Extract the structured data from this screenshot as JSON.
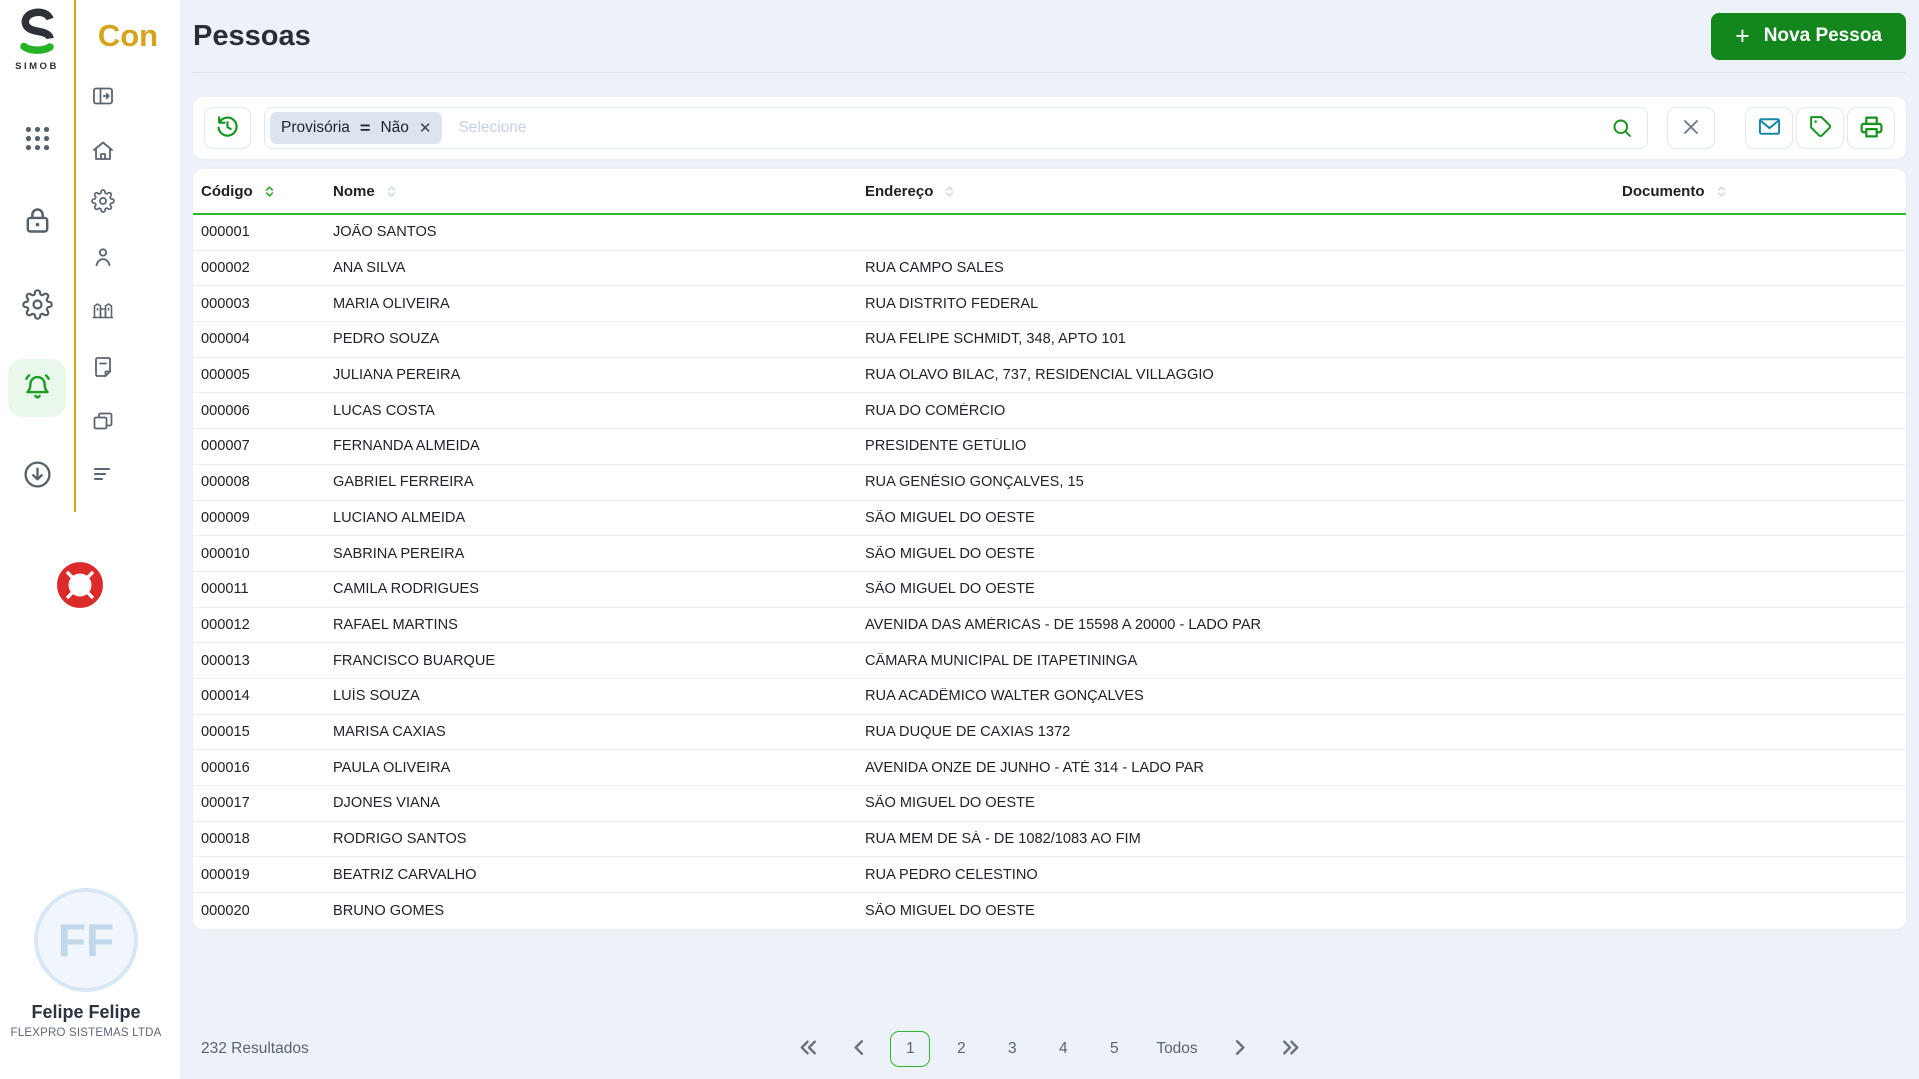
{
  "brand": {
    "logo_letter": "S",
    "logo_caption": "SIMOB",
    "app_name": "Con"
  },
  "sidebar": {
    "outer_items": [
      {
        "name": "apps-grid-icon",
        "active": false
      },
      {
        "name": "lock-icon",
        "active": false
      },
      {
        "name": "gear-icon",
        "active": false
      },
      {
        "name": "bell-icon",
        "active": true
      },
      {
        "name": "download-icon",
        "active": false
      }
    ],
    "inner_items": [
      {
        "name": "panel-expand-icon"
      },
      {
        "name": "home-icon"
      },
      {
        "name": "gear-icon"
      },
      {
        "name": "user-icon"
      },
      {
        "name": "building-icon"
      },
      {
        "name": "note-icon"
      },
      {
        "name": "copy-icon"
      },
      {
        "name": "align-left-icon"
      }
    ],
    "help_icon": "lifebuoy-icon"
  },
  "header": {
    "title": "Pessoas",
    "new_button_plus": "+",
    "new_button_label": "Nova Pessoa"
  },
  "filter": {
    "chip": {
      "field": "Provisória",
      "operator": "=",
      "value": "Não",
      "remove_label": "✕"
    },
    "placeholder": "Selecione"
  },
  "table": {
    "columns": [
      {
        "label": "Código",
        "sort_active": true
      },
      {
        "label": "Nome",
        "sort_active": false
      },
      {
        "label": "Endereço",
        "sort_active": false
      },
      {
        "label": "Documento",
        "sort_active": false
      }
    ],
    "rows": [
      {
        "code": "000001",
        "name": "JOÃO SANTOS",
        "address": "",
        "document": ""
      },
      {
        "code": "000002",
        "name": "ANA SILVA",
        "address": "RUA CAMPO SALES",
        "document": ""
      },
      {
        "code": "000003",
        "name": "MARIA OLIVEIRA",
        "address": "RUA DISTRITO FEDERAL",
        "document": ""
      },
      {
        "code": "000004",
        "name": "PEDRO SOUZA",
        "address": "RUA FELIPE SCHMIDT, 348, APTO 101",
        "document": ""
      },
      {
        "code": "000005",
        "name": "JULIANA PEREIRA",
        "address": "RUA OLAVO BILAC, 737, RESIDENCIAL VILLAGGIO",
        "document": ""
      },
      {
        "code": "000006",
        "name": "LUCAS COSTA",
        "address": "RUA DO COMÉRCIO",
        "document": ""
      },
      {
        "code": "000007",
        "name": "FERNANDA ALMEIDA",
        "address": "PRESIDENTE GETÚLIO",
        "document": ""
      },
      {
        "code": "000008",
        "name": "GABRIEL FERREIRA",
        "address": "RUA GENÉSIO GONÇALVES, 15",
        "document": ""
      },
      {
        "code": "000009",
        "name": "LUCIANO ALMEIDA",
        "address": "SÃO MIGUEL DO OESTE",
        "document": ""
      },
      {
        "code": "000010",
        "name": "SABRINA PEREIRA",
        "address": "SÃO MIGUEL DO OESTE",
        "document": ""
      },
      {
        "code": "000011",
        "name": "CAMILA RODRIGUES",
        "address": "SÃO MIGUEL DO OESTE",
        "document": ""
      },
      {
        "code": "000012",
        "name": "RAFAEL MARTINS",
        "address": "AVENIDA DAS AMÉRICAS - DE 15598 A 20000 - LADO PAR",
        "document": ""
      },
      {
        "code": "000013",
        "name": "FRANCISCO BUARQUE",
        "address": "CÂMARA MUNICIPAL DE ITAPETININGA",
        "document": ""
      },
      {
        "code": "000014",
        "name": "LUÍS SOUZA",
        "address": "RUA ACADÊMICO WALTER GONÇALVES",
        "document": ""
      },
      {
        "code": "000015",
        "name": "MARISA CAXIAS",
        "address": "RUA DUQUE DE CAXIAS 1372",
        "document": ""
      },
      {
        "code": "000016",
        "name": "PAULA OLIVEIRA",
        "address": "AVENIDA ONZE DE JUNHO - ATÉ 314 - LADO PAR",
        "document": ""
      },
      {
        "code": "000017",
        "name": "DJONES VIANA",
        "address": "SÃO MIGUEL DO OESTE",
        "document": ""
      },
      {
        "code": "000018",
        "name": "RODRIGO SANTOS",
        "address": "RUA MEM DE SÁ - DE 1082/1083 AO FIM",
        "document": ""
      },
      {
        "code": "000019",
        "name": "BEATRIZ CARVALHO",
        "address": "RUA PEDRO CELESTINO",
        "document": ""
      },
      {
        "code": "000020",
        "name": "BRUNO GOMES",
        "address": "SÃO MIGUEL DO OESTE",
        "document": ""
      }
    ]
  },
  "pagination": {
    "results_text": "232 Resultados",
    "pages": [
      "1",
      "2",
      "3",
      "4",
      "5",
      "Todos"
    ],
    "active_page": "1"
  },
  "user": {
    "initials": "FF",
    "name": "Felipe Felipe",
    "company": "FLEXPRO SISTEMAS LTDA"
  },
  "colors": {
    "primary_green": "#13861d",
    "bright_green": "#2cb92c",
    "gold": "#d7a31c",
    "teal": "#1887a8",
    "red": "#dc2b2b",
    "background": "#edf2f9"
  }
}
